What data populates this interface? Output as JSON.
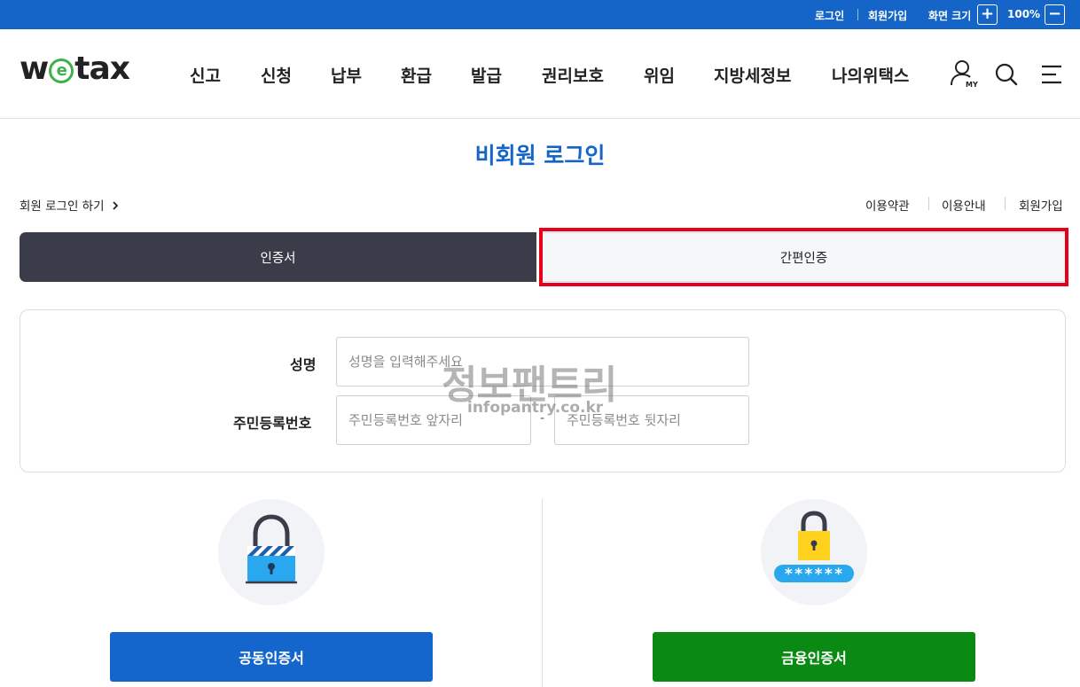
{
  "topbar": {
    "login": "로그인",
    "signup": "회원가입",
    "zoom_label": "화면 크기",
    "zoom_in": "+",
    "zoom_value": "100%",
    "zoom_out": "−",
    "color": "#1565c8"
  },
  "header": {
    "logo": {
      "pre": "w",
      "mid": "e",
      "post": "tax"
    },
    "nav": [
      "신고",
      "신청",
      "납부",
      "환급",
      "발급",
      "권리보호",
      "위임",
      "지방세정보",
      "나의위택스"
    ],
    "icons": [
      "my-page-icon",
      "search-icon",
      "menu-icon"
    ],
    "my_badge": "MY"
  },
  "page": {
    "title": "비회원 로그인",
    "member_login_link": "회원 로그인 하기",
    "links": [
      "이용약관",
      "이용안내",
      "회원가입"
    ]
  },
  "tabs": {
    "certificate": "인증서",
    "simple_auth": "간편인증",
    "active": "certificate"
  },
  "form": {
    "name_label": "성명",
    "name_placeholder": "성명을 입력해주세요",
    "rrn_label": "주민등록번호",
    "rrn_front_placeholder": "주민등록번호 앞자리",
    "rrn_back_placeholder": "주민등록번호 뒷자리",
    "rrn_separator": "-"
  },
  "watermark": {
    "text": "정보팬트리",
    "url": "infopantry.co.kr"
  },
  "methods": {
    "joint_cert": {
      "label": "공동인증서",
      "color": "#1466cc",
      "icon": "padlock-striped-icon"
    },
    "financial_cert": {
      "label": "금융인증서",
      "color": "#0a8a12",
      "icon": "padlock-password-icon",
      "password_mask": "******"
    }
  },
  "colors": {
    "title_blue": "#1565c8",
    "tab_dark": "#3b3c4a",
    "highlight_red": "#e8001b"
  }
}
